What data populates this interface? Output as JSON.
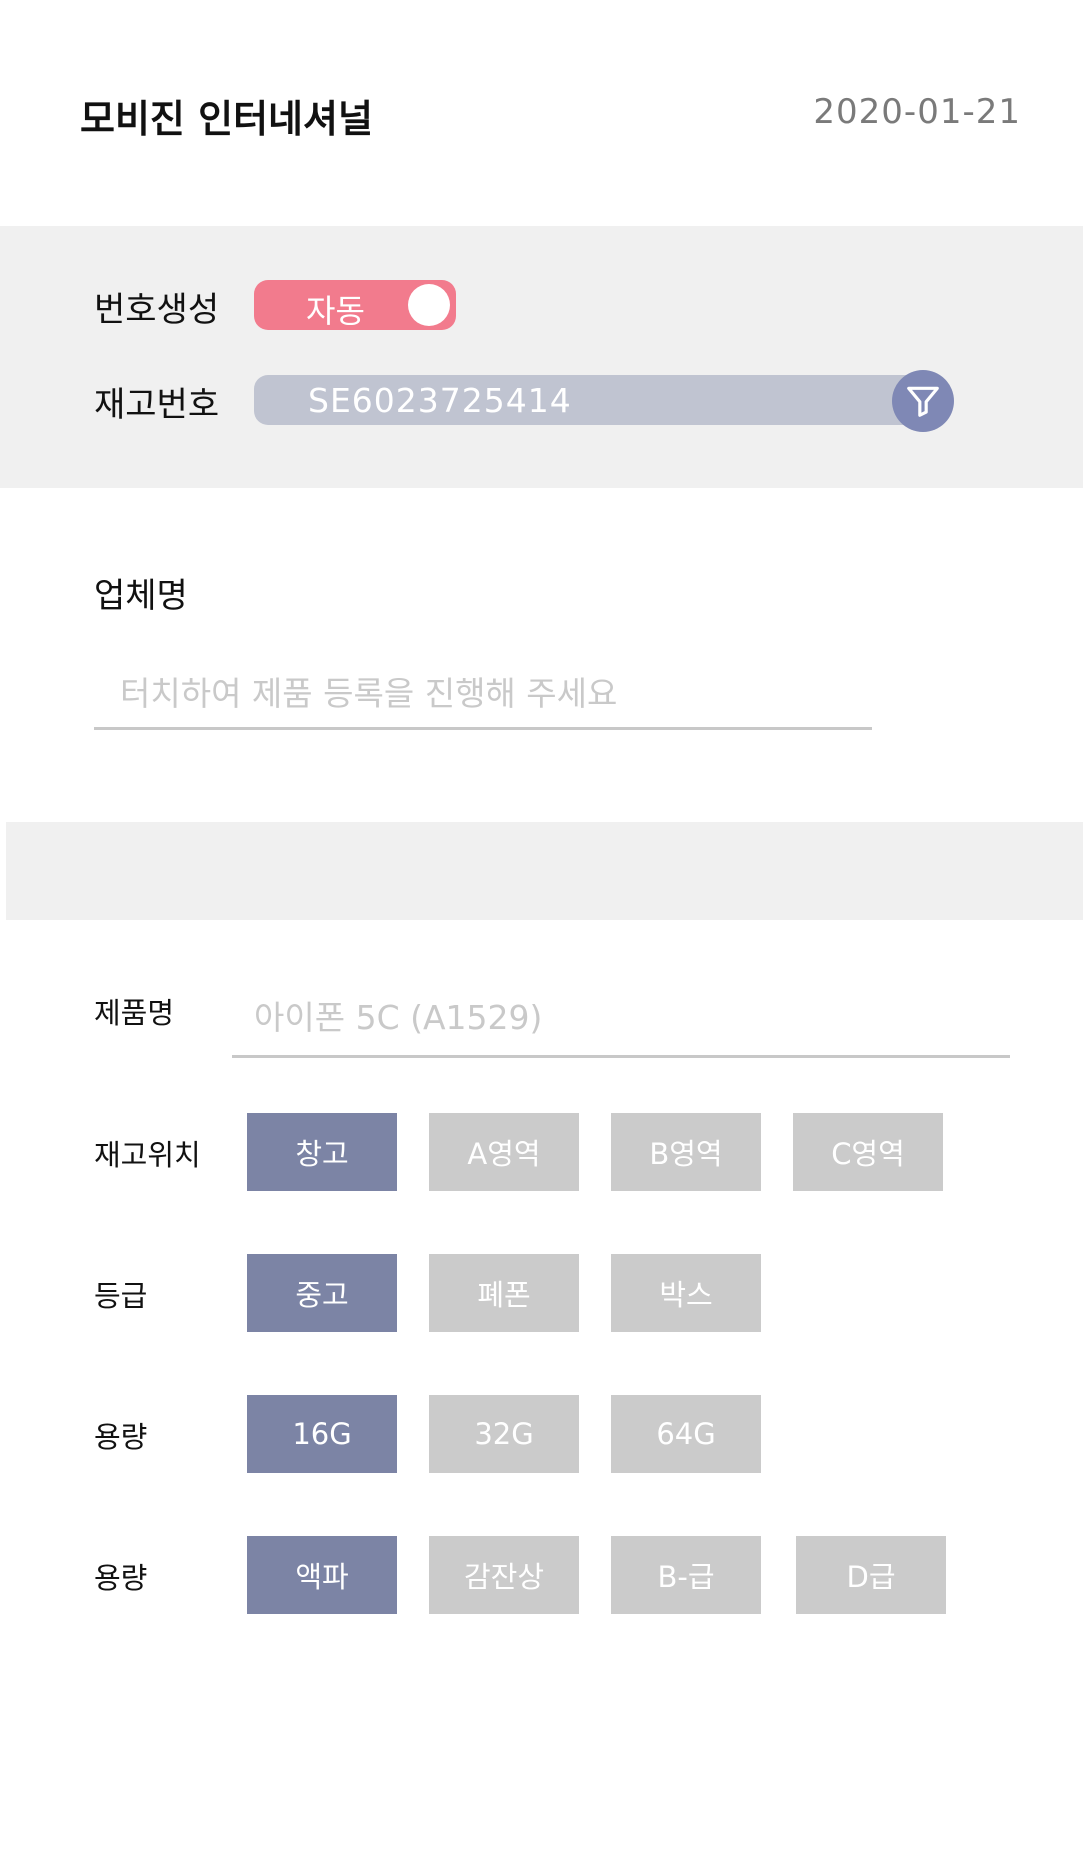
{
  "header": {
    "title": "모비진 인터네셔널",
    "date": "2020-01-21"
  },
  "numbering": {
    "label": "번호생성",
    "toggle_text": "자동",
    "toggle_on": true
  },
  "stock": {
    "label": "재고번호",
    "value": "SE6023725414",
    "filter_icon": "filter-icon"
  },
  "company": {
    "label": "업체명",
    "placeholder": "터치하여 제품 등록을 진행해 주세요"
  },
  "product": {
    "label": "제품명",
    "placeholder": "아이폰 5C (A1529)"
  },
  "options": [
    {
      "label": "재고위치",
      "chips": [
        {
          "text": "창고",
          "active": true
        },
        {
          "text": "A영역",
          "active": false
        },
        {
          "text": "B영역",
          "active": false
        },
        {
          "text": "C영역",
          "active": false
        }
      ]
    },
    {
      "label": "등급",
      "chips": [
        {
          "text": "중고",
          "active": true
        },
        {
          "text": "폐폰",
          "active": false
        },
        {
          "text": "박스",
          "active": false
        }
      ]
    },
    {
      "label": "용량",
      "chips": [
        {
          "text": "16G",
          "active": true
        },
        {
          "text": "32G",
          "active": false
        },
        {
          "text": "64G",
          "active": false
        }
      ]
    },
    {
      "label": "용량",
      "chips": [
        {
          "text": "액파",
          "active": true
        },
        {
          "text": "감잔상",
          "active": false
        },
        {
          "text": "B-급",
          "active": false
        },
        {
          "text": "D급",
          "active": false
        }
      ]
    }
  ],
  "colors": {
    "toggle_active": "#f27b8d",
    "chip_active": "#7c84a5",
    "chip_inactive": "#cbcbcb",
    "stock_field": "#c0c4d1",
    "filter_button": "#7f88b5",
    "panel_bg": "#f0f0f0"
  }
}
